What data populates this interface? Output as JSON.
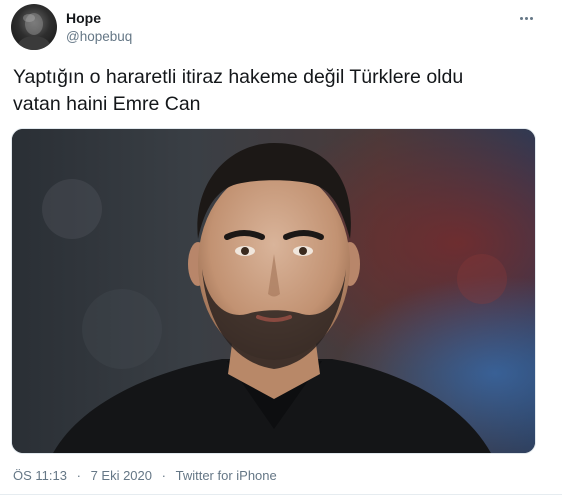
{
  "user": {
    "display_name": "Hope",
    "handle": "@hopebuq"
  },
  "icons": {
    "more": "more-horizontal-icon",
    "avatar": "user-avatar-image"
  },
  "tweet": {
    "text_line_1": "Yaptığın o hararetli itiraz hakeme değil Türklere oldu",
    "text_line_2": "vatan haini Emre Can",
    "media_description_icon": "photo"
  },
  "meta": {
    "time": "ÖS 11:13",
    "separator": "·",
    "date": "7 Eki 2020",
    "source": "Twitter for iPhone"
  },
  "colors": {
    "text_primary": "#14171a",
    "text_secondary": "#657786",
    "border": "#e1e8ed"
  }
}
